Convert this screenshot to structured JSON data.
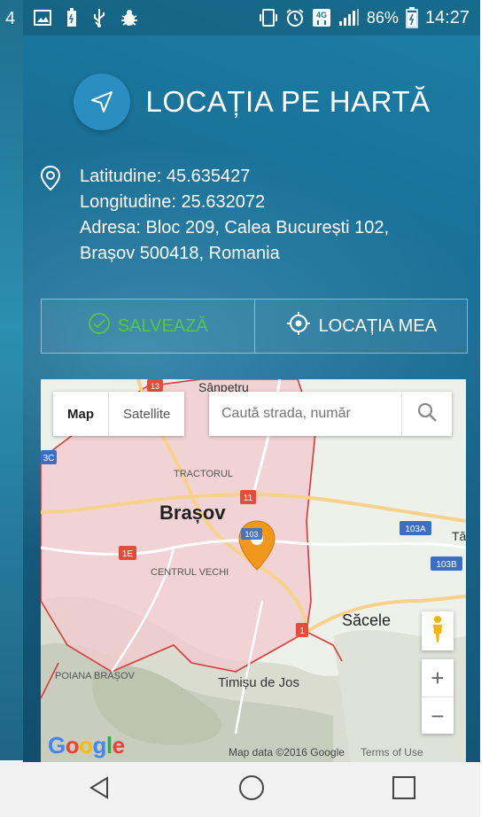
{
  "status_bar": {
    "left_icons": [
      "image-icon",
      "battery-saver-icon",
      "usb-icon",
      "debug-icon"
    ],
    "battery_percent": "86%",
    "time": "14:27",
    "network": "4G"
  },
  "left_peek": {
    "digit": "4"
  },
  "header": {
    "title": "LOCAȚIA PE HARTĂ",
    "icon": "navigation-arrow-icon"
  },
  "location": {
    "latitude": "Latitudine: 45.635427",
    "longitude": "Longitudine: 25.632072",
    "address_line1": "Adresa: Bloc 209, Calea București 102,",
    "address_line2": "Brașov 500418, Romania"
  },
  "actions": {
    "save_label": "SALVEAZĂ",
    "my_location_label": "LOCAȚIA MEA"
  },
  "map": {
    "type_map": "Map",
    "type_satellite": "Satellite",
    "search_placeholder": "Caută strada, număr",
    "labels": {
      "sanpetru": "Sânpetru",
      "tractorul": "TRACTORUL",
      "brasov": "Brașov",
      "centrul_vechi": "CENTRUL VECHI",
      "sacele": "Săcele",
      "poiana_brasov": "POIANA BRAȘOV",
      "timisu_de_jos": "Timișu de Jos",
      "ta": "Tă",
      "road_103a": "103A",
      "road_103b": "103B",
      "road_3c": "3C",
      "road_1e": "1E",
      "road_1": "1",
      "road_103_pin": "103",
      "road_13": "13",
      "road_11": "11"
    },
    "zoom_in": "+",
    "zoom_out": "−",
    "google": "Google",
    "attribution": "Map data ©2016 Google",
    "terms": "Terms of Use"
  },
  "navbar": {
    "back": "back-triangle-icon",
    "home": "home-circle-icon",
    "recents": "recents-square-icon"
  },
  "colors": {
    "accent_blue": "#2a8ec0",
    "save_green": "#58c73a",
    "pin_orange": "#f0981c"
  }
}
